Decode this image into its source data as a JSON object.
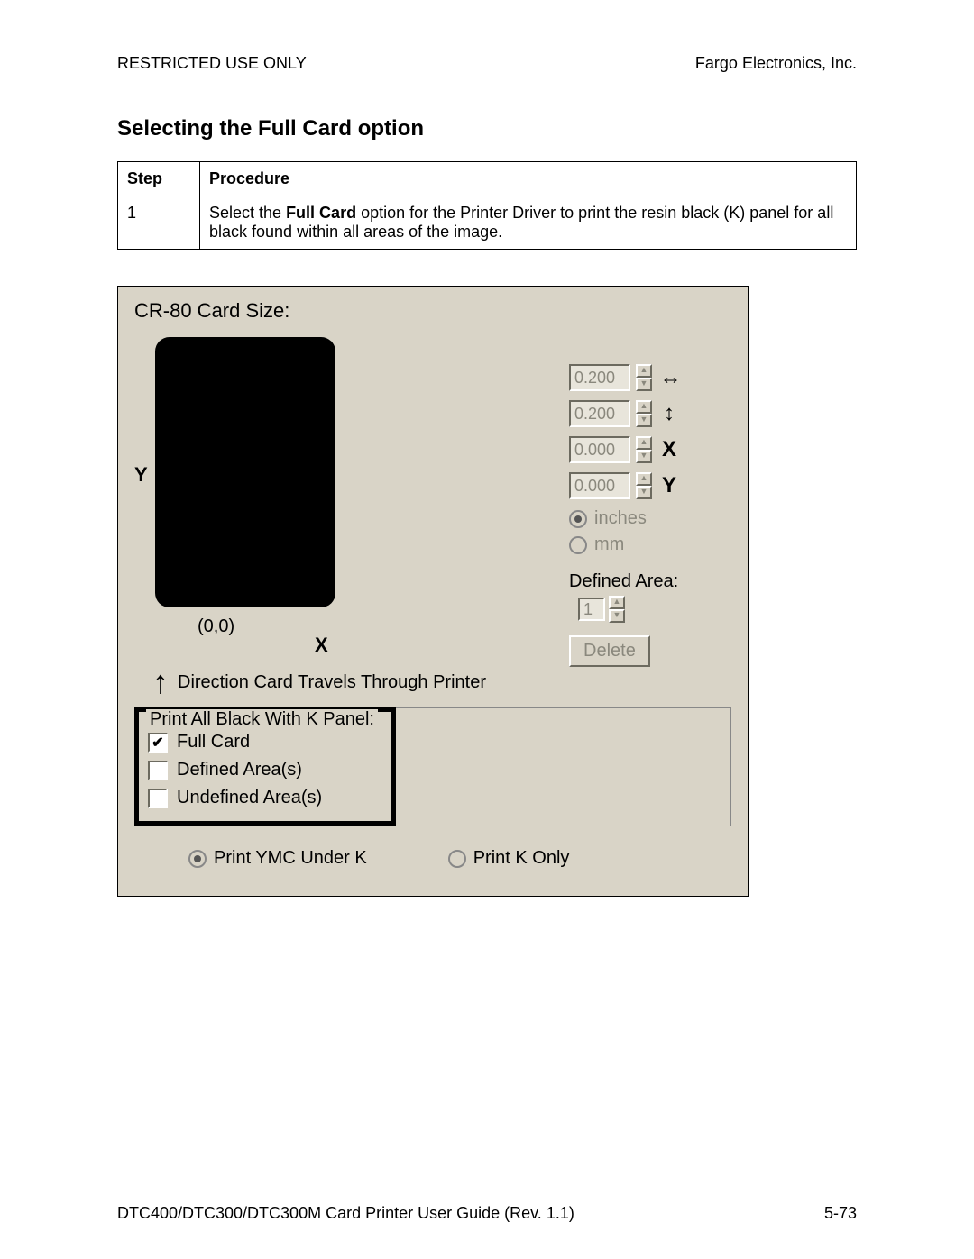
{
  "header": {
    "restricted": "RESTRICTED USE ONLY",
    "company": "Fargo Electronics, Inc."
  },
  "section_title": "Selecting the Full Card option",
  "table": {
    "h_step": "Step",
    "h_proc": "Procedure",
    "row1_num": "1",
    "row1_pre": "Select the ",
    "row1_bold": "Full Card",
    "row1_post": " option for the Printer Driver to print the resin black (K) panel for all black found within all areas of the image."
  },
  "dialog": {
    "title": "CR-80 Card Size:",
    "y_label": "Y",
    "x_label": "X",
    "origin": "(0,0)",
    "direction": "Direction Card Travels Through Printer",
    "spinners": {
      "w": "0.200",
      "h": "0.200",
      "x": "0.000",
      "y": "0.000",
      "w_icon": "↔",
      "h_icon": "↕",
      "x_icon": "X",
      "y_icon": "Y"
    },
    "units": {
      "inches": "inches",
      "mm": "mm"
    },
    "defined_area_label": "Defined Area:",
    "defined_area_value": "1",
    "delete": "Delete",
    "kpanel": {
      "legend": "Print All Black With K Panel:",
      "full_card": "Full Card",
      "defined": "Defined Area(s)",
      "undefined": "Undefined Area(s)"
    },
    "bottom": {
      "ymc": "Print YMC Under K",
      "konly": "Print K Only"
    }
  },
  "footer": {
    "guide": "DTC400/DTC300/DTC300M Card Printer User Guide (Rev. 1.1)",
    "page": "5-73"
  }
}
